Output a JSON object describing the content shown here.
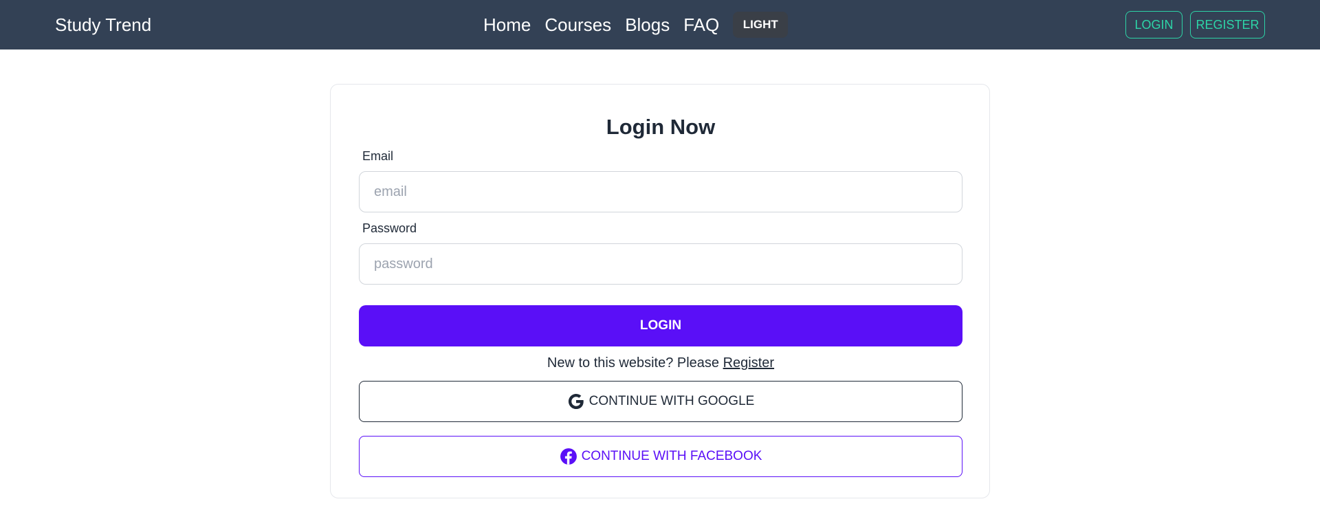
{
  "header": {
    "brand": "Study Trend",
    "nav": [
      "Home",
      "Courses",
      "Blogs",
      "FAQ"
    ],
    "theme_toggle": "LIGHT",
    "login_label": "LOGIN",
    "register_label": "REGISTER"
  },
  "form": {
    "title": "Login Now",
    "email_label": "Email",
    "email_placeholder": "email",
    "password_label": "Password",
    "password_placeholder": "password",
    "submit_label": "LOGIN",
    "signup_prompt": "New to this website? Please ",
    "signup_link": "Register",
    "google_label": "CONTINUE WITH GOOGLE",
    "facebook_label": "CONTINUE WITH FACEBOOK"
  },
  "colors": {
    "navbar": "#334155",
    "accent": "#2dd4a7",
    "primary": "#5a0ff7"
  },
  "icons": {
    "google": "google-icon",
    "facebook": "facebook-icon"
  }
}
